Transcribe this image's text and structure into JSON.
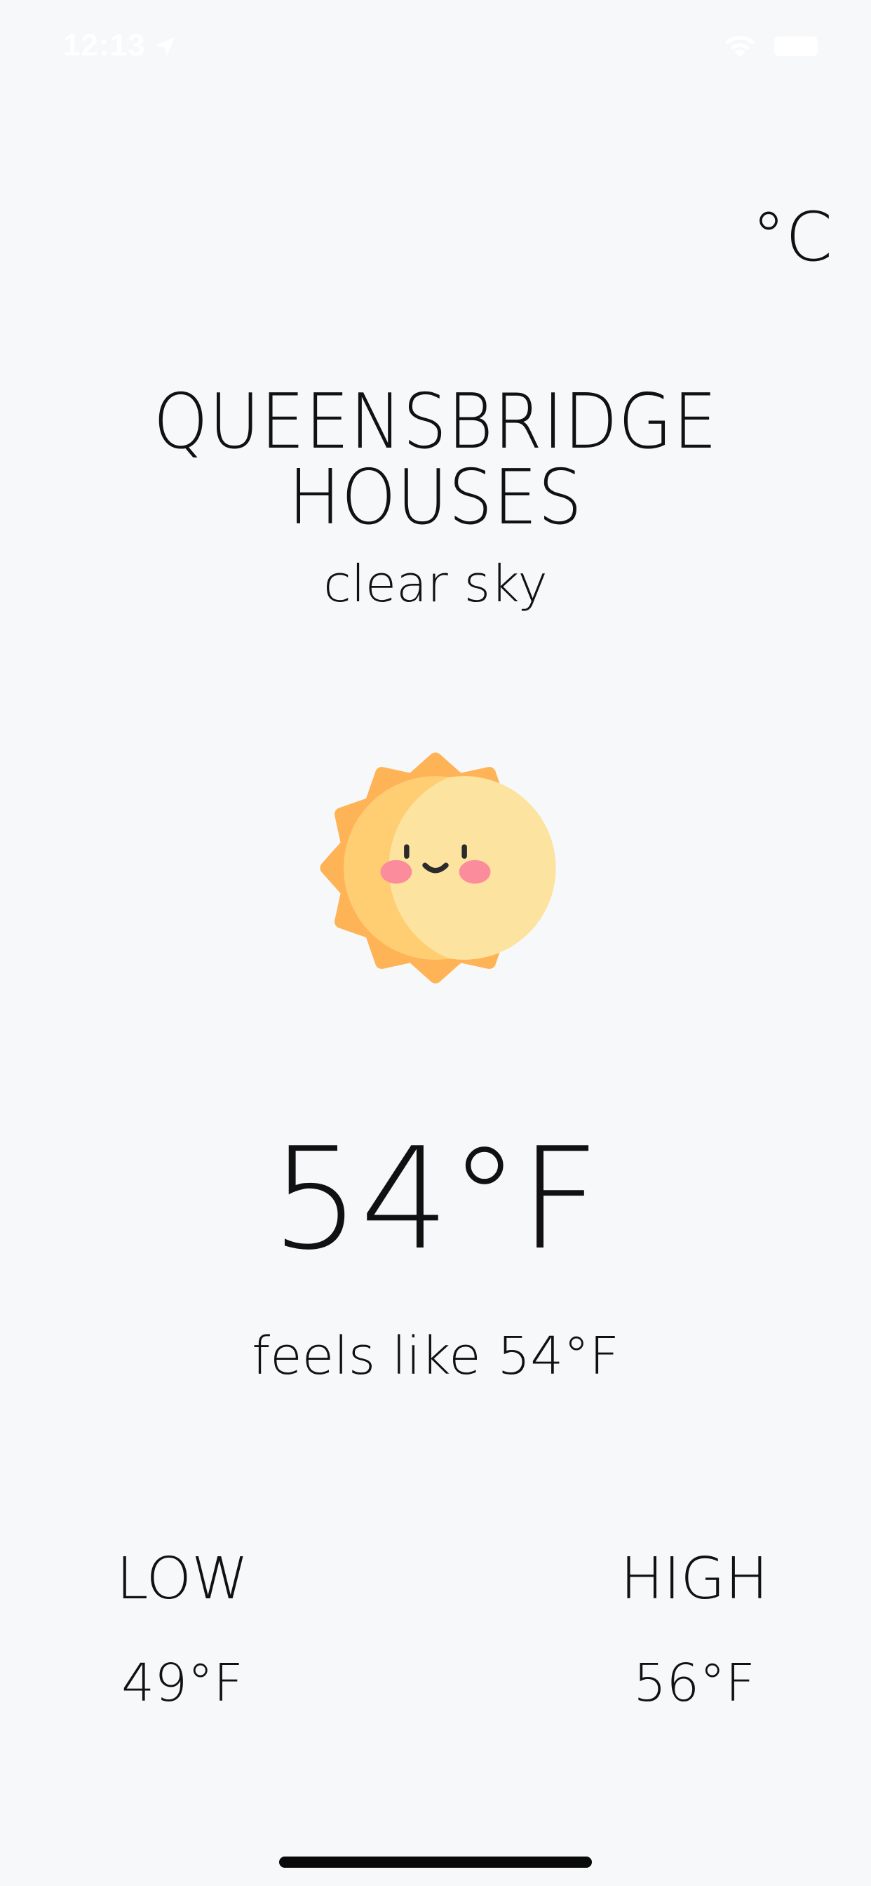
{
  "status_bar": {
    "time": "12:13",
    "location_icon": "location-arrow-icon",
    "wifi_icon": "wifi-icon",
    "battery_icon": "battery-icon"
  },
  "unit_toggle": {
    "label": "°C"
  },
  "location": {
    "name": "QUEENSBRIDGE HOUSES"
  },
  "weather": {
    "condition": "clear sky",
    "icon": "sun-icon",
    "temperature": "54°F",
    "feels_like": "feels like 54°F"
  },
  "range": {
    "low_label": "LOW",
    "low_value": "49°F",
    "high_label": "HIGH",
    "high_value": "56°F"
  },
  "colors": {
    "background": "#f7f8fa",
    "sun_rays": "#ffb357",
    "sun_outer": "#ffcd72",
    "sun_inner": "#fde3a0",
    "cheeks": "#fb8c9c",
    "text": "#111111"
  }
}
